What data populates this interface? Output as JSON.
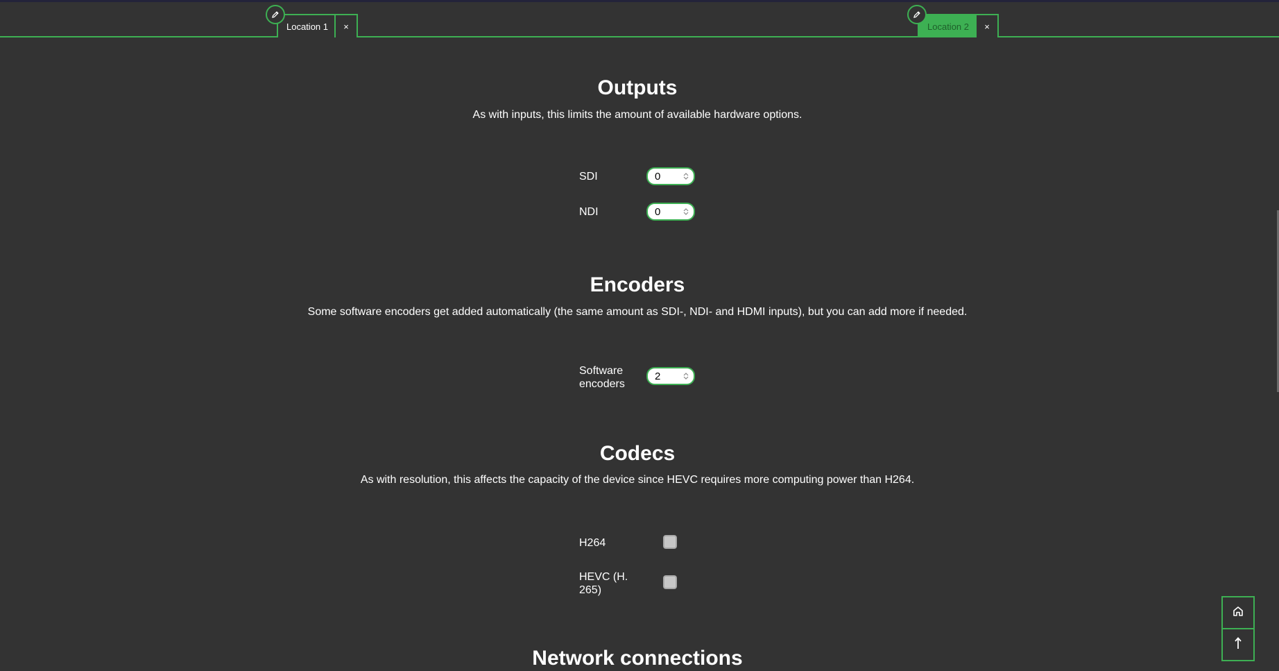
{
  "tabs": [
    {
      "label": "Location 1",
      "active": false,
      "close": "×"
    },
    {
      "label": "Location 2",
      "active": true,
      "close": "×"
    }
  ],
  "outputs": {
    "title": "Outputs",
    "description": "As with inputs, this limits the amount of available hardware options.",
    "fields": [
      {
        "label": "SDI",
        "value": "0"
      },
      {
        "label": "NDI",
        "value": "0"
      }
    ]
  },
  "encoders": {
    "title": "Encoders",
    "description": "Some software encoders get added automatically (the same amount as SDI-, NDI- and HDMI inputs), but you can add more if needed.",
    "fields": [
      {
        "label": "Software encoders",
        "value": "2"
      }
    ]
  },
  "codecs": {
    "title": "Codecs",
    "description": "As with resolution, this affects the capacity of the device since HEVC requires more computing power than H264.",
    "options": [
      {
        "label": "H264",
        "checked": false
      },
      {
        "label": "HEVC (H. 265)",
        "checked": false
      }
    ]
  },
  "network": {
    "title": "Network connections"
  },
  "icons": {
    "edit": "pencil-icon",
    "home": "home-icon",
    "top": "arrow-up-icon"
  },
  "colors": {
    "accent": "#3db053",
    "background": "#333333"
  }
}
